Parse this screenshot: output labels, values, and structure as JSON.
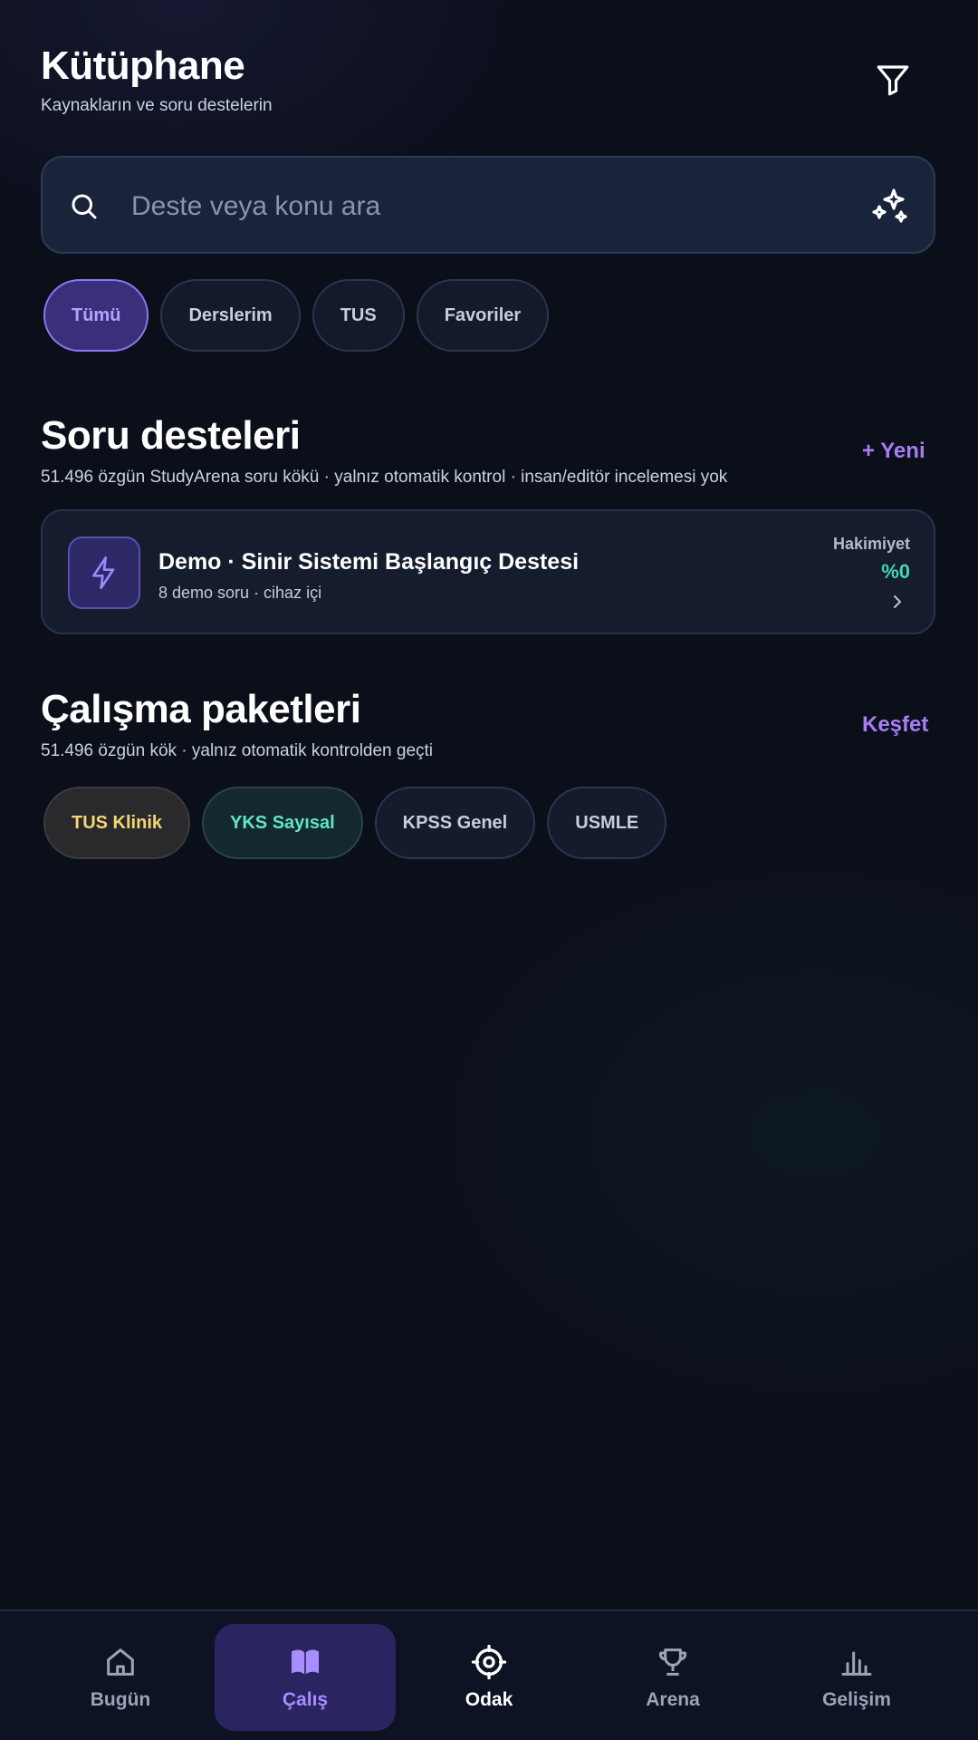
{
  "header": {
    "title": "Kütüphane",
    "subtitle": "Kaynakların ve soru destelerin"
  },
  "search": {
    "placeholder": "Deste veya konu ara",
    "value": ""
  },
  "filters": [
    {
      "label": "Tümü",
      "active": true
    },
    {
      "label": "Derslerim",
      "active": false
    },
    {
      "label": "TUS",
      "active": false
    },
    {
      "label": "Favoriler",
      "active": false
    }
  ],
  "decks_section": {
    "title": "Soru desteleri",
    "subtitle": "51.496 özgün StudyArena soru kökü · yalnız otomatik kontrol · insan/editör incelemesi yok",
    "action_label": "+ Yeni",
    "deck": {
      "title": "Demo · Sinir Sistemi Başlangıç Destesi",
      "meta": "8 demo soru · cihaz içi",
      "mastery_label": "Hakimiyet",
      "mastery_value": "%0"
    }
  },
  "packs_section": {
    "title": "Çalışma paketleri",
    "subtitle": "51.496 özgün kök · yalnız otomatik kontrolden geçti",
    "action_label": "Keşfet",
    "packs": [
      {
        "label": "TUS Klinik"
      },
      {
        "label": "YKS Sayısal"
      },
      {
        "label": "KPSS Genel"
      },
      {
        "label": "USMLE"
      }
    ]
  },
  "bottom_nav": [
    {
      "label": "Bugün",
      "icon": "home-icon"
    },
    {
      "label": "Çalış",
      "icon": "book-icon",
      "active": true
    },
    {
      "label": "Odak",
      "icon": "target-icon"
    },
    {
      "label": "Arena",
      "icon": "trophy-icon"
    },
    {
      "label": "Gelişim",
      "icon": "bar-chart-icon"
    }
  ],
  "colors": {
    "background": "#0b0f1a",
    "accent": "#a77cf5",
    "mastery": "#3fd8b4",
    "pack_yellow": "#f3d675",
    "pack_teal": "#5fe6c3"
  }
}
